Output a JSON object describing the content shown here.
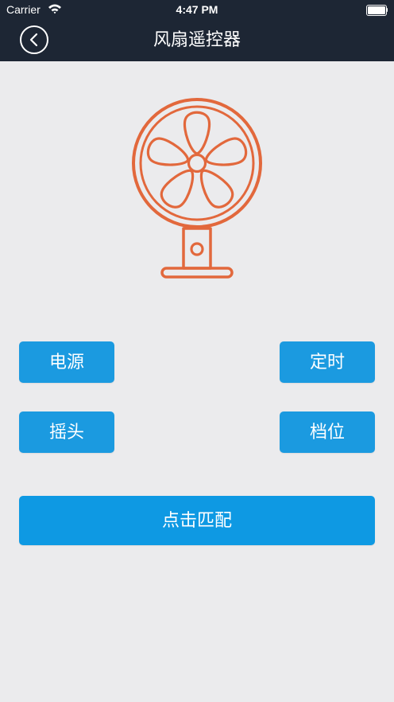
{
  "status_bar": {
    "carrier": "Carrier",
    "time": "4:47 PM",
    "battery_level": 1.0,
    "wifi_icon": "wifi-icon",
    "battery_icon": "battery-icon"
  },
  "nav": {
    "title": "风扇遥控器",
    "back_icon": "chevron-left-icon"
  },
  "illustration": {
    "icon": "fan-icon"
  },
  "controls": {
    "power_label": "电源",
    "timer_label": "定时",
    "swing_label": "摇头",
    "speed_label": "档位",
    "match_label": "点击匹配"
  },
  "colors": {
    "header": "#1d2634",
    "background": "#ebebed",
    "accent": "#1b9ae0",
    "fan": "#e2683c"
  }
}
